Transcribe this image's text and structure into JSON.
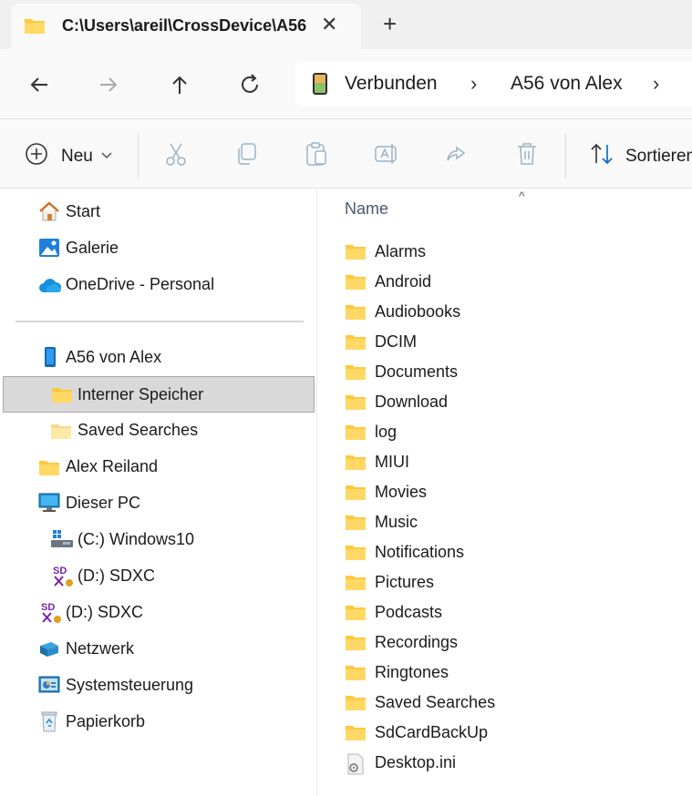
{
  "tab": {
    "title": "C:\\Users\\areil\\CrossDevice\\A56",
    "close_label": "✕",
    "new_tab_label": "+"
  },
  "address": {
    "segments": [
      "Verbunden",
      "A56 von Alex"
    ],
    "separator": "›"
  },
  "toolbar": {
    "new_label": "Neu",
    "sort_label": "Sortieren"
  },
  "sidebar": {
    "quick": [
      {
        "label": "Start",
        "icon": "home-icon"
      },
      {
        "label": "Galerie",
        "icon": "gallery-icon"
      },
      {
        "label": "OneDrive - Personal",
        "icon": "onedrive-icon"
      }
    ],
    "tree": [
      {
        "label": "A56 von Alex",
        "icon": "phone-icon"
      },
      {
        "label": "Interner Speicher",
        "icon": "folder-icon",
        "selected": true
      },
      {
        "label": "Saved Searches",
        "icon": "folder-light-icon"
      },
      {
        "label": "Alex Reiland",
        "icon": "folder-icon"
      },
      {
        "label": "Dieser PC",
        "icon": "monitor-icon"
      },
      {
        "label": "(C:) Windows10",
        "icon": "drive-icon"
      },
      {
        "label": "(D:) SDXC",
        "icon": "sd-card-icon"
      },
      {
        "label": "(D:) SDXC",
        "icon": "sd-card-icon"
      },
      {
        "label": "Netzwerk",
        "icon": "network-icon"
      },
      {
        "label": "Systemsteuerung",
        "icon": "control-panel-icon"
      },
      {
        "label": "Papierkorb",
        "icon": "recycle-bin-icon"
      }
    ]
  },
  "content": {
    "column_header": "Name",
    "sort_indicator": "^",
    "files": [
      {
        "name": "Alarms",
        "type": "folder"
      },
      {
        "name": "Android",
        "type": "folder"
      },
      {
        "name": "Audiobooks",
        "type": "folder"
      },
      {
        "name": "DCIM",
        "type": "folder"
      },
      {
        "name": "Documents",
        "type": "folder"
      },
      {
        "name": "Download",
        "type": "folder"
      },
      {
        "name": "log",
        "type": "folder"
      },
      {
        "name": "MIUI",
        "type": "folder"
      },
      {
        "name": "Movies",
        "type": "folder"
      },
      {
        "name": "Music",
        "type": "folder"
      },
      {
        "name": "Notifications",
        "type": "folder"
      },
      {
        "name": "Pictures",
        "type": "folder"
      },
      {
        "name": "Podcasts",
        "type": "folder"
      },
      {
        "name": "Recordings",
        "type": "folder"
      },
      {
        "name": "Ringtones",
        "type": "folder"
      },
      {
        "name": "Saved Searches",
        "type": "folder"
      },
      {
        "name": "SdCardBackUp",
        "type": "folder"
      },
      {
        "name": "Desktop.ini",
        "type": "file"
      }
    ]
  },
  "colors": {
    "folder": "#ffc83d",
    "folder_light": "#fde9a6",
    "accent": "#0067c0"
  }
}
